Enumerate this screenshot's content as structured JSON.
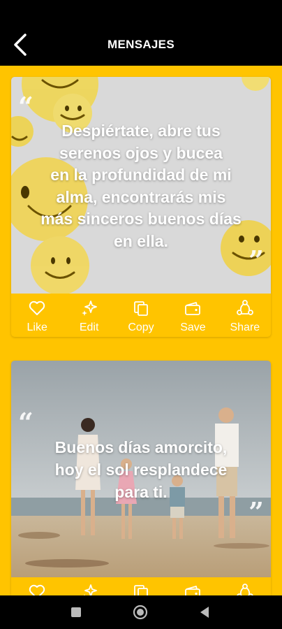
{
  "header": {
    "title": "MENSAJES",
    "back_icon": "back-arrow-icon"
  },
  "actions": [
    {
      "label": "Like",
      "icon": "heart-icon"
    },
    {
      "label": "Edit",
      "icon": "sparkle-icon"
    },
    {
      "label": "Copy",
      "icon": "copy-icon"
    },
    {
      "label": "Save",
      "icon": "wallet-icon"
    },
    {
      "label": "Share",
      "icon": "share-icon"
    }
  ],
  "cards": [
    {
      "lines": [
        "Despiértate, abre tus",
        "serenos ojos y bucea",
        "en la profundidad de mi",
        "alma, encontrarás mis",
        "más sinceros buenos días",
        "en ella."
      ],
      "image": "smiley-faces-background"
    },
    {
      "lines": [
        "Buenos días amorcito,",
        "hoy el sol resplandece",
        "para ti."
      ],
      "image": "family-on-beach-photo"
    }
  ],
  "quote_marks": {
    "open": "“",
    "close": "”"
  },
  "nav": {
    "buttons": [
      "recent-apps-icon",
      "home-icon",
      "back-icon"
    ]
  },
  "colors": {
    "accent": "#FFC400",
    "topbar": "#000000",
    "text": "#FFFFFF"
  }
}
